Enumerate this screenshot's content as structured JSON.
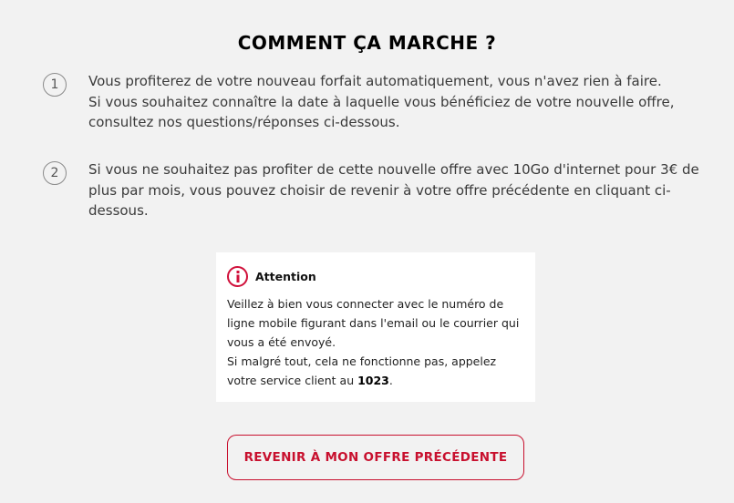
{
  "title": "COMMENT ÇA MARCHE ?",
  "steps": [
    {
      "number": "1",
      "lines": [
        "Vous profiterez de votre nouveau forfait automatiquement, vous n'avez rien à faire.",
        "Si vous souhaitez connaître la date à laquelle vous bénéficiez de votre nouvelle offre, consultez nos questions/réponses ci-dessous."
      ]
    },
    {
      "number": "2",
      "lines": [
        "Si vous ne souhaitez pas profiter de cette nouvelle offre avec 10Go d'internet pour 3€ de plus par mois, vous pouvez choisir de revenir à votre offre précédente en cliquant ci-dessous."
      ]
    }
  ],
  "alert": {
    "icon": "info-icon",
    "title": "Attention",
    "line1": "Veillez à bien vous connecter avec le numéro de ligne mobile figurant dans l'email ou le courrier qui vous a été envoyé.",
    "line2_prefix": "Si malgré tout, cela ne fonctionne pas, appelez votre service client au ",
    "line2_number": "1023",
    "line2_suffix": "."
  },
  "cta_label": "REVENIR À MON OFFRE PRÉCÉDENTE",
  "colors": {
    "accent": "#c8102e",
    "background": "#f2f2f2"
  }
}
